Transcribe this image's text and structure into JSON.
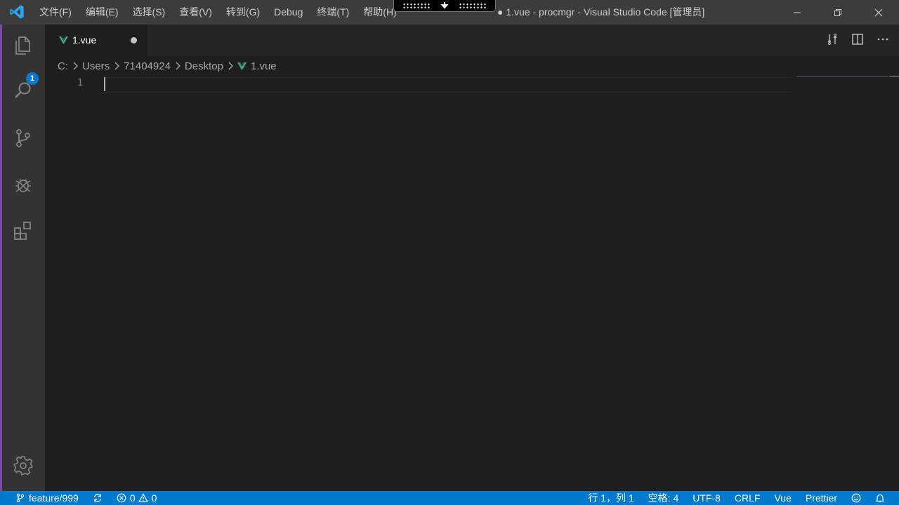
{
  "app": {
    "window_title": "● 1.vue - procmgr - Visual Studio Code [管理员]"
  },
  "menu": [
    "文件(F)",
    "编辑(E)",
    "选择(S)",
    "查看(V)",
    "转到(G)",
    "Debug",
    "终端(T)",
    "帮助(H)"
  ],
  "activity_bar": {
    "explorer_badge": "1",
    "items": [
      "explorer-icon",
      "search-icon",
      "source-control-icon",
      "debug-icon",
      "extensions-icon"
    ],
    "bottom": "settings-gear-icon"
  },
  "tab": {
    "label": "1.vue",
    "icon": "vue-icon",
    "dirty": true
  },
  "breadcrumb": [
    "C:",
    "Users",
    "71404924",
    "Desktop",
    "1.vue"
  ],
  "editor": {
    "line_numbers": [
      "1"
    ]
  },
  "statusbar": {
    "branch": "feature/999",
    "errors": "0",
    "warnings": "0",
    "position": "行 1，列 1",
    "indent": "空格: 4",
    "encoding": "UTF-8",
    "eol": "CRLF",
    "language": "Vue",
    "formatter": "Prettier"
  },
  "colors": {
    "accent": "#007acc",
    "vue_green": "#41b883",
    "titlebar": "#3c3c3c",
    "activitybar": "#333333",
    "editor_bg": "#1e1e1e"
  }
}
